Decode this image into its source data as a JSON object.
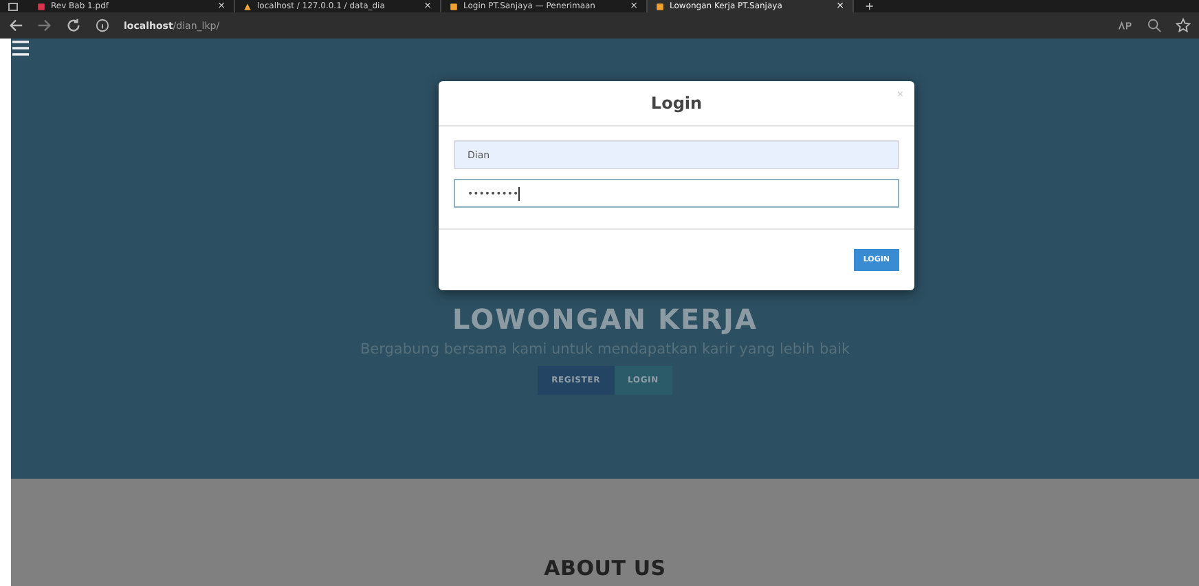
{
  "browser": {
    "tabs": [
      {
        "title": "Rev Bab 1.pdf",
        "close": "×",
        "selected": false
      },
      {
        "title": "localhost / 127.0.0.1 / data_dia",
        "close": "×",
        "selected": false
      },
      {
        "title": "Login PT.Sanjaya — Penerimaan",
        "close": "×",
        "selected": false
      },
      {
        "title": "Lowongan Kerja PT.Sanjaya",
        "close": "×",
        "selected": true
      }
    ],
    "new_tab": "+",
    "address": {
      "host": "localhost",
      "path": "/dian_lkp/"
    }
  },
  "hero": {
    "title": "LOWONGAN KERJA",
    "subtitle": "Bergabung bersama kami untuk mendapatkan karir yang lebih baik",
    "buttons": [
      {
        "label": "REGISTER",
        "kind": "primary"
      },
      {
        "label": "LOGIN",
        "kind": "secondary"
      }
    ]
  },
  "about": {
    "title": "ABOUT US"
  },
  "modal": {
    "title": "Login",
    "close": "×",
    "fields": [
      {
        "value": "Dian",
        "autofilled": true,
        "focused": false
      },
      {
        "value": "•••••••••",
        "autofilled": false,
        "focused": true
      }
    ],
    "submit": "LOGIN"
  }
}
